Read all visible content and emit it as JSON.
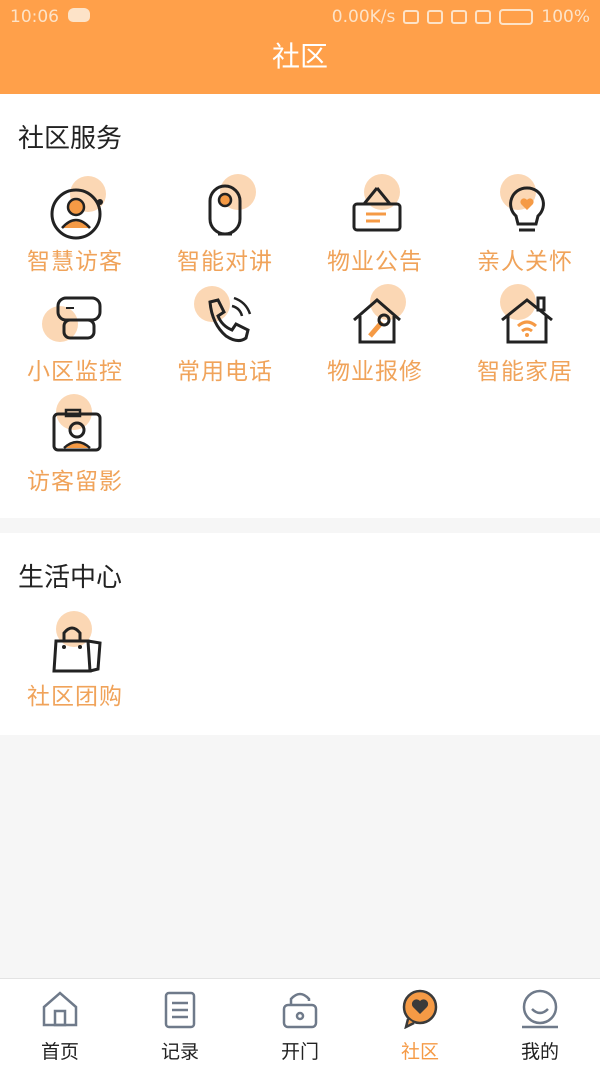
{
  "status_bar": {
    "time": "10:06",
    "network_speed": "0.00K/s",
    "battery": "100%"
  },
  "header": {
    "title": "社区"
  },
  "community_services": {
    "title": "社区服务",
    "items": [
      {
        "label": "智慧访客",
        "icon": "visitor-icon"
      },
      {
        "label": "智能对讲",
        "icon": "intercom-icon"
      },
      {
        "label": "物业公告",
        "icon": "notice-icon"
      },
      {
        "label": "亲人关怀",
        "icon": "care-bulb-icon"
      },
      {
        "label": "小区监控",
        "icon": "camera-monitor-icon"
      },
      {
        "label": "常用电话",
        "icon": "phone-icon"
      },
      {
        "label": "物业报修",
        "icon": "repair-house-icon"
      },
      {
        "label": "智能家居",
        "icon": "smart-home-icon"
      },
      {
        "label": "访客留影",
        "icon": "visitor-photo-icon"
      }
    ]
  },
  "life_center": {
    "title": "生活中心",
    "items": [
      {
        "label": "社区团购",
        "icon": "shopping-bag-icon"
      }
    ]
  },
  "tabbar": {
    "items": [
      {
        "label": "首页",
        "icon": "home-icon",
        "active": false
      },
      {
        "label": "记录",
        "icon": "list-icon",
        "active": false
      },
      {
        "label": "开门",
        "icon": "lock-icon",
        "active": false
      },
      {
        "label": "社区",
        "icon": "community-heart-icon",
        "active": true
      },
      {
        "label": "我的",
        "icon": "profile-icon",
        "active": false
      }
    ]
  },
  "colors": {
    "accent": "#ffa04a",
    "label": "#f0a35a",
    "blob": "#fbd7b4",
    "icon_orange": "#f59a45"
  }
}
